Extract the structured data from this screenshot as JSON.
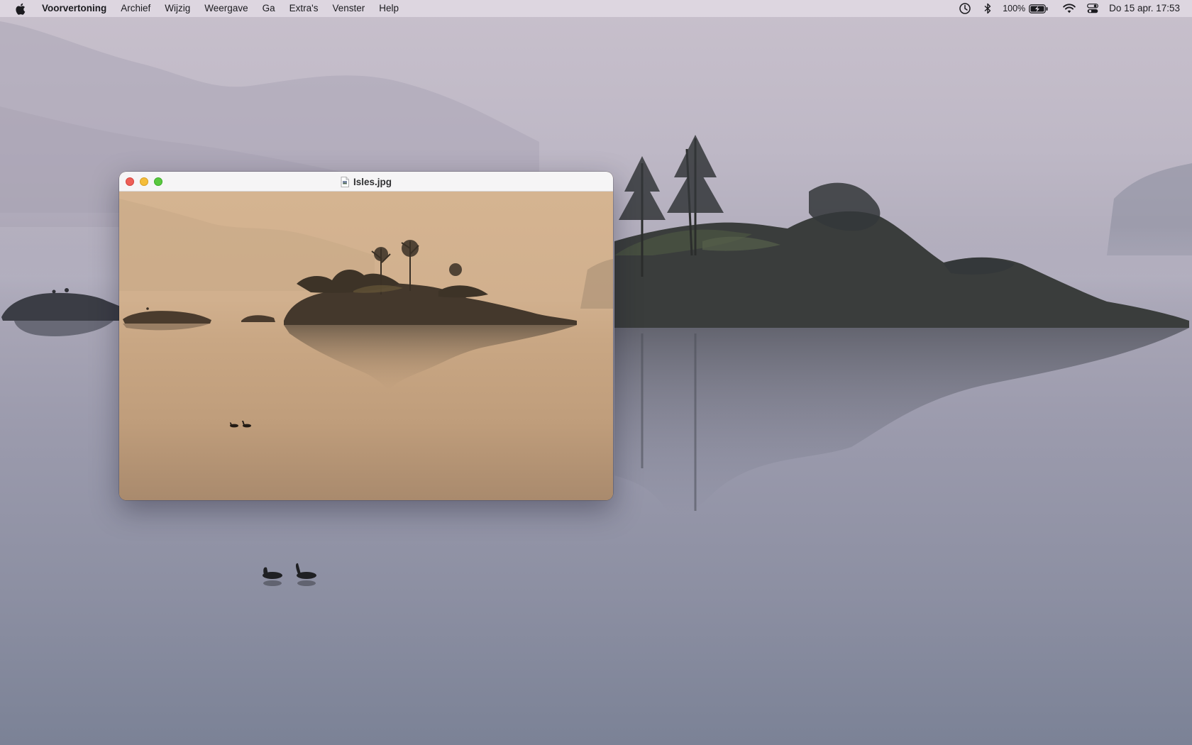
{
  "menubar": {
    "app_name": "Voorvertoning",
    "items": [
      "Archief",
      "Wijzig",
      "Weergave",
      "Ga",
      "Extra's",
      "Venster",
      "Help"
    ],
    "battery_percent": "100%",
    "clock": "Do 15 apr.  17:53",
    "icons": [
      "apple-icon",
      "time-machine-icon",
      "bluetooth-icon",
      "battery-charging-icon",
      "wifi-icon",
      "control-center-icon"
    ]
  },
  "window": {
    "title": "Isles.jpg",
    "icon": "jpeg-document-icon"
  },
  "colors": {
    "close": "#ee5f57",
    "minimize": "#f5bd3a",
    "zoom": "#5ac83f"
  }
}
